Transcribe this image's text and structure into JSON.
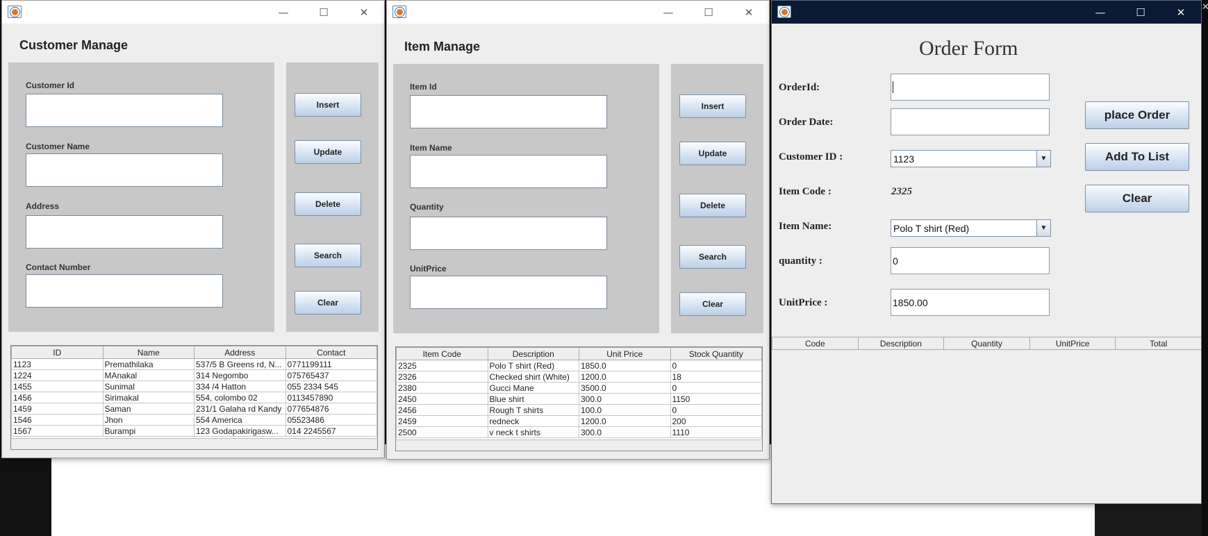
{
  "customer_window": {
    "heading": "Customer Manage",
    "fields": [
      {
        "label": "Customer Id",
        "value": ""
      },
      {
        "label": "Customer Name",
        "value": ""
      },
      {
        "label": "Address",
        "value": ""
      },
      {
        "label": "Contact Number",
        "value": ""
      }
    ],
    "buttons": [
      "Insert",
      "Update",
      "Delete",
      "Search",
      "Clear"
    ],
    "table": {
      "columns": [
        "ID",
        "Name",
        "Address",
        "Contact"
      ],
      "rows": [
        [
          "1123",
          "Premathilaka",
          "537/5 B Greens rd, N...",
          "0771199111"
        ],
        [
          "1224",
          "MAnakal",
          "314 Negombo",
          "075765437"
        ],
        [
          "1455",
          "Sunimal",
          "334 /4 Hatton",
          "055 2334 545"
        ],
        [
          "1456",
          "Sirimakal",
          "554, colombo 02",
          "0113457890"
        ],
        [
          "1459",
          "Saman",
          "231/1 Galaha rd Kandy",
          "077654876"
        ],
        [
          "1546",
          "Jhon",
          "554 America",
          "05523486"
        ],
        [
          "1567",
          "Burampi",
          "123 Godapakirigasw...",
          "014 2245567"
        ]
      ]
    }
  },
  "item_window": {
    "heading": "Item Manage",
    "fields": [
      {
        "label": "Item Id",
        "value": ""
      },
      {
        "label": "Item Name",
        "value": ""
      },
      {
        "label": "Quantity",
        "value": ""
      },
      {
        "label": "UnitPrice",
        "value": ""
      }
    ],
    "buttons": [
      "Insert",
      "Update",
      "Delete",
      "Search",
      "Clear"
    ],
    "table": {
      "columns": [
        "Item Code",
        "Description",
        "Unit Price",
        "Stock Quantity"
      ],
      "rows": [
        [
          "2325",
          "Polo T shirt (Red)",
          "1850.0",
          "0"
        ],
        [
          "2326",
          "Checked  shirt (White)",
          "1200.0",
          "18"
        ],
        [
          "2380",
          "Gucci Mane",
          "3500.0",
          "0"
        ],
        [
          "2450",
          "Blue shirt",
          "300.0",
          "1150"
        ],
        [
          "2456",
          "Rough T shirts",
          "100.0",
          "0"
        ],
        [
          "2459",
          "redneck",
          "1200.0",
          "200"
        ],
        [
          "2500",
          "v neck t shirts",
          "300.0",
          "1110"
        ]
      ]
    }
  },
  "order_window": {
    "title": "Order Form",
    "labels": {
      "order_id": "OrderId:",
      "order_date": "Order Date:",
      "customer_id": "Customer ID :",
      "item_code": "Item Code :",
      "item_name": "Item Name:",
      "quantity": "quantity :",
      "unit_price": "UnitPrice :"
    },
    "values": {
      "order_id": "",
      "order_date": "",
      "customer_id": "1123",
      "item_code": "2325",
      "item_name": "Polo T shirt (Red)",
      "quantity": "0",
      "unit_price": "1850.00"
    },
    "buttons": [
      "place Order",
      "Add To List",
      "Clear"
    ],
    "table_columns": [
      "Code",
      "Description",
      "Quantity",
      "UnitPrice",
      "Total"
    ]
  },
  "icons": {
    "app": "java-coffee-icon",
    "minimize": "minimize-icon",
    "maximize": "maximize-icon",
    "close": "close-icon",
    "dropdown": "chevron-down-icon"
  },
  "colors": {
    "panel": "#c8c8c8",
    "window_bg": "#eeeeee",
    "dark_titlebar": "#0b1a33",
    "button_gradient_bottom": "#bcd0e6"
  }
}
